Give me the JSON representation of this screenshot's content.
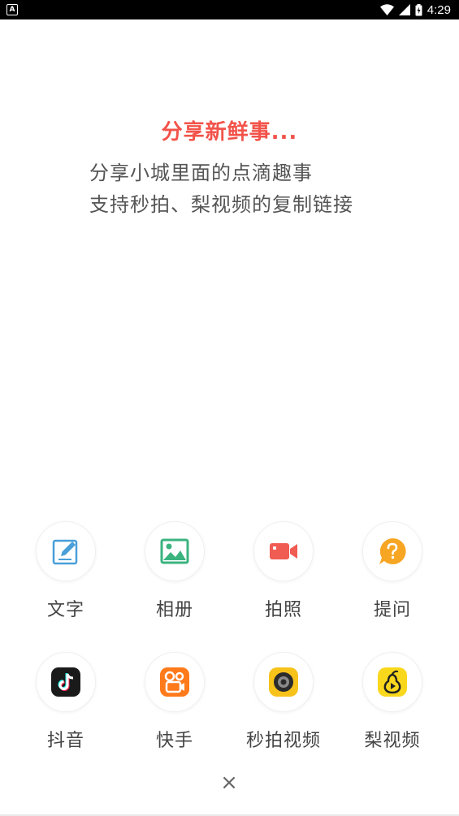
{
  "status_bar": {
    "app_badge": "A",
    "time": "4:29",
    "icons": [
      "wifi-icon",
      "cellular-signal-icon",
      "battery-icon"
    ]
  },
  "header": {
    "title": "分享新鲜事...",
    "desc_line_1": "分享小城里面的点滴趣事",
    "desc_line_2": "支持秒拍、梨视频的复制链接"
  },
  "tiles": [
    {
      "label": "文字",
      "icon": "edit-icon",
      "color": "#4a9fd8"
    },
    {
      "label": "相册",
      "icon": "image-icon",
      "color": "#3bb37f"
    },
    {
      "label": "拍照",
      "icon": "video-camera-icon",
      "color": "#f05b52"
    },
    {
      "label": "提问",
      "icon": "question-bubble-icon",
      "color": "#f6a623"
    },
    {
      "label": "抖音",
      "icon": "douyin-icon",
      "color": "#1a1a1a"
    },
    {
      "label": "快手",
      "icon": "kuaishou-icon",
      "color": "#ff7a1a"
    },
    {
      "label": "秒拍视频",
      "icon": "miaopai-icon",
      "color": "#f7c21a"
    },
    {
      "label": "梨视频",
      "icon": "pear-video-icon",
      "color": "#f9d71c"
    }
  ],
  "close_glyph": "×",
  "colors": {
    "title": "#f2534a",
    "description": "#555555",
    "label": "#444444"
  }
}
